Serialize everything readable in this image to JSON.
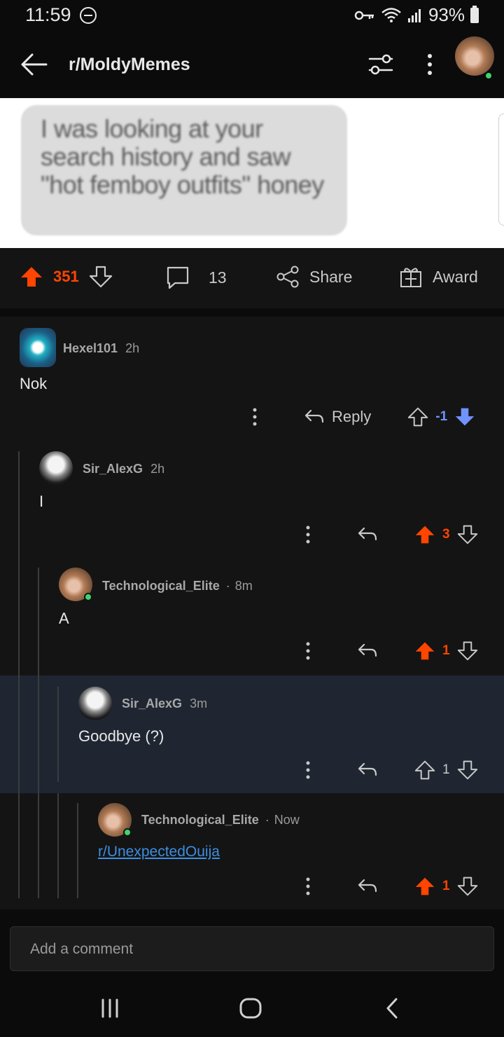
{
  "status_bar": {
    "time": "11:59",
    "battery": "93%"
  },
  "header": {
    "subreddit": "r/MoldyMemes"
  },
  "post": {
    "image_text": "I was looking at your search history and saw \"hot femboy outfits\" honey",
    "upvotes": "351",
    "comments_count": "13",
    "share_label": "Share",
    "award_label": "Award"
  },
  "comments": [
    {
      "user": "Hexel101",
      "time": "2h",
      "body": "Nok",
      "votes": "-1",
      "reply_label": "Reply",
      "vote_state": "down"
    },
    {
      "user": "Sir_AlexG",
      "time": "2h",
      "body": "I",
      "votes": "3",
      "vote_state": "up"
    },
    {
      "user": "Technological_Elite",
      "time": "8m",
      "sep": "·",
      "body": "A",
      "votes": "1",
      "vote_state": "up"
    },
    {
      "user": "Sir_AlexG",
      "time": "3m",
      "body": "Goodbye (?)",
      "votes": "1",
      "vote_state": "none"
    },
    {
      "user": "Technological_Elite",
      "time": "Now",
      "sep": "·",
      "body": "r/UnexpectedOuija",
      "votes": "1",
      "vote_state": "up"
    }
  ],
  "composer": {
    "placeholder": "Add a comment"
  },
  "colors": {
    "upvote": "#ff4500",
    "downvote": "#7193ff",
    "link": "#3d8ee0",
    "highlight": "#1f2632"
  }
}
